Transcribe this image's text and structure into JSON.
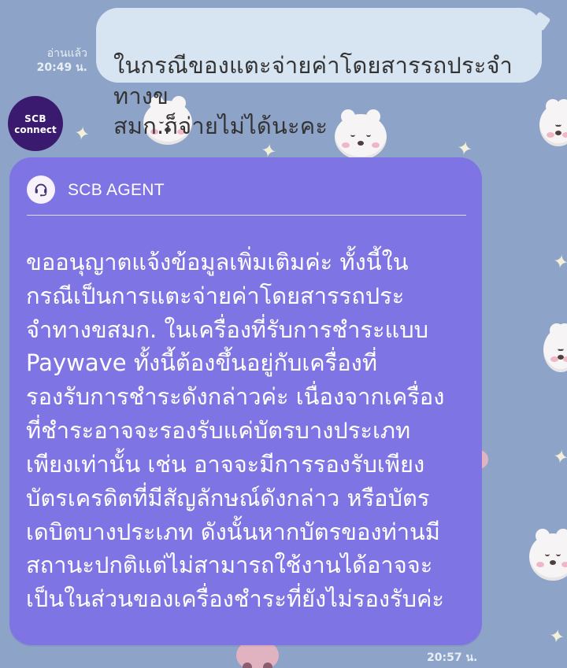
{
  "chat": {
    "user_message": "ในกรณีของแตะจ่ายค่าโดยสารรถประจำทางข\nสมก.ก็จ่ายไม่ได้นะคะ",
    "read_status": "อ่านแล้ว",
    "read_time": "20:49 น.",
    "agent_avatar_top": "SCB",
    "agent_avatar_bottom": "connect",
    "agent_title": "SCB AGENT",
    "agent_message": "ขออนุญาตแจ้งข้อมูลเพิ่มเติมค่ะ ทั้งนี้ใน\nกรณีเป็นการแตะจ่ายค่าโดยสารรถประ\nจำทางขสมก. ในเครื่องที่รับการชำระแบบ\nPaywave  ทั้งนี้ต้องขึ้นอยู่กับเครื่องที่\nรองรับการชำระดังกล่าวค่ะ เนื่องจากเครื่อง\nที่ชำระอาจจะรองรับแค่บัตรบางประเภท\nเพียงเท่านั้น เช่น อาจจะมีการรองรับเพียง\nบัตรเครดิตที่มีสัญลักษณ์ดังกล่าว หรือบัตร\nเดบิตบางประเภท ดังนั้นหากบัตรของท่านมี\nสถานะปกติแต่ไม่สามารถใช้งานได้อาจจะ\nเป็นในส่วนของเครื่องชำระที่ยังไม่รองรับค่ะ",
    "bottom_time": "20:57 น."
  },
  "colors": {
    "background": "#8ea3c8",
    "user_bubble": "#d7e4f2",
    "agent_card": "#7f74e3",
    "avatar": "#3a1a6f"
  },
  "icons": {
    "agent_icon": "headset-icon"
  }
}
